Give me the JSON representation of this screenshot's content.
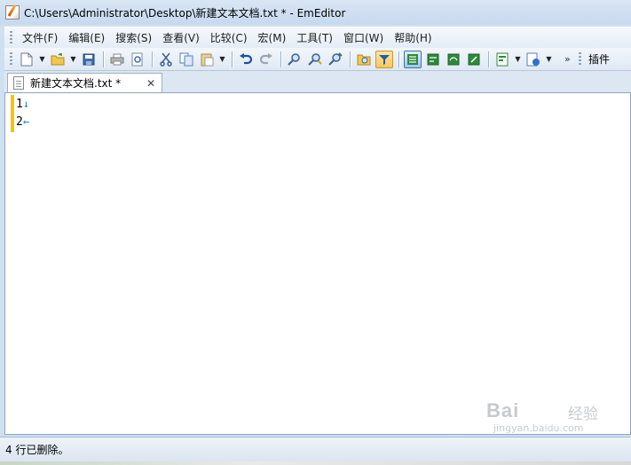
{
  "window": {
    "title": "C:\\Users\\Administrator\\Desktop\\新建文本文档.txt * - EmEditor"
  },
  "menu": {
    "items": [
      {
        "label": "文件(F)"
      },
      {
        "label": "编辑(E)"
      },
      {
        "label": "搜索(S)"
      },
      {
        "label": "查看(V)"
      },
      {
        "label": "比较(C)"
      },
      {
        "label": "宏(M)"
      },
      {
        "label": "工具(T)"
      },
      {
        "label": "窗口(W)"
      },
      {
        "label": "帮助(H)"
      }
    ]
  },
  "toolbar": {
    "more_glyph": "»",
    "plugins_label": "插件"
  },
  "tab": {
    "label": "新建文本文档.txt *",
    "close_glyph": "✕"
  },
  "editor": {
    "lines": [
      {
        "number": "1",
        "mark": "↓"
      },
      {
        "number": "2",
        "mark": "←"
      }
    ]
  },
  "status": {
    "text": "4 行已删除。"
  },
  "watermark": {
    "brand": "Bai",
    "sub": "经验",
    "url": "jingyan.baidu.com"
  },
  "colors": {
    "accent": "#1a7fd0",
    "modified_line_marker": "#f5c400"
  }
}
